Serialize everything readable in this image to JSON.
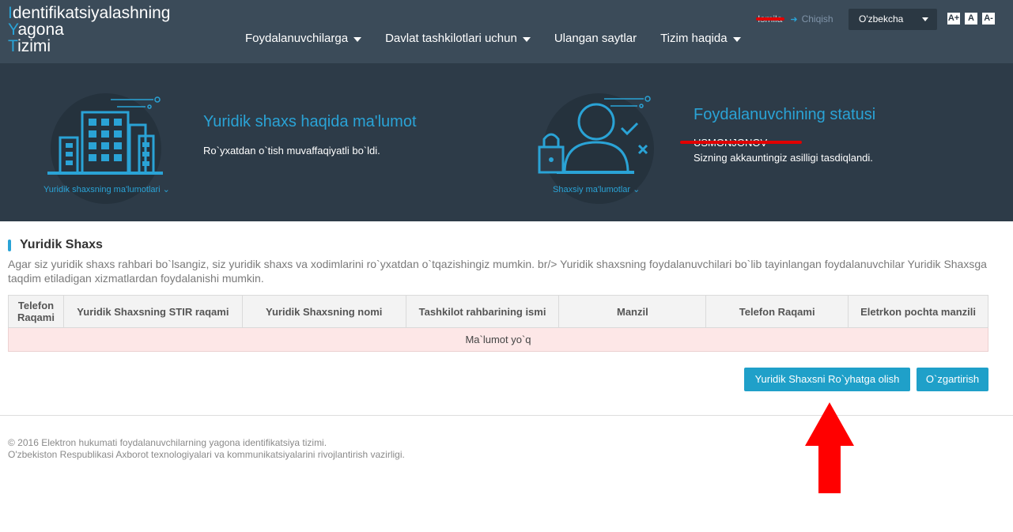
{
  "header": {
    "logo_lines": [
      "Identifikatsiyalashning",
      "Yagona",
      "Tizimi"
    ],
    "nav": [
      {
        "label": "Foydalanuvchilarga",
        "dropdown": true
      },
      {
        "label": "Davlat tashkilotlari uchun",
        "dropdown": true
      },
      {
        "label": "Ulangan saytlar",
        "dropdown": false
      },
      {
        "label": "Tizim haqida",
        "dropdown": true
      }
    ],
    "username": "Ismila",
    "logout_label": "Chiqish",
    "language": "O'zbekcha",
    "font_controls": [
      "A+",
      "A",
      "A-"
    ]
  },
  "banner": {
    "left": {
      "icon": "building-icon",
      "circle_label": "Yuridik shaxsning ma'lumotlari",
      "title": "Yuridik shaxs haqida ma'lumot",
      "text": "Ro`yxatdan o`tish muvaffaqiyatli bo`ldi."
    },
    "right": {
      "icon": "user-lock-icon",
      "circle_label": "Shaxsiy ma'lumotlar",
      "title": "Foydalanuvchining statusi",
      "name": "USMONJONOV",
      "text": "Sizning akkauntingiz asilligi tasdiqlandi."
    }
  },
  "main": {
    "title": "Yuridik Shaxs",
    "description": "Agar siz yuridik shaxs rahbari bo`lsangiz, siz yuridik shaxs va xodimlarini ro`yxatdan o`tqazishingiz mumkin. br/> Yuridik shaxsning foydalanuvchilari bo`lib tayinlangan foydalanuvchilar Yuridik Shaxsga taqdim etiladigan xizmatlardan foydalanishi mumkin.",
    "table": {
      "columns": [
        "Telefon Raqami",
        "Yuridik Shaxsning STIR raqami",
        "Yuridik Shaxsning nomi",
        "Tashkilot rahbarining ismi",
        "Manzil",
        "Telefon Raqami",
        "Eletrkon pochta manzili"
      ],
      "empty_message": "Ma`lumot yo`q"
    },
    "register_button": "Yuridik Shaxsni Ro`yhatga olish",
    "edit_button": "O`zgartirish"
  },
  "footer": {
    "line1": "© 2016 Elektron hukumati foydalanuvchilarning yagona identifikatsiya tizimi.",
    "line2": "O'zbekiston Respublikasi Axborot texnologiyalari va kommunikatsiyalarini rivojlantirish vazirligi."
  },
  "colors": {
    "header_bg": "#3b4b59",
    "banner_bg": "#2d3b48",
    "accent": "#2aa3d6",
    "button": "#1fa0c9",
    "annotation": "#e10000"
  }
}
